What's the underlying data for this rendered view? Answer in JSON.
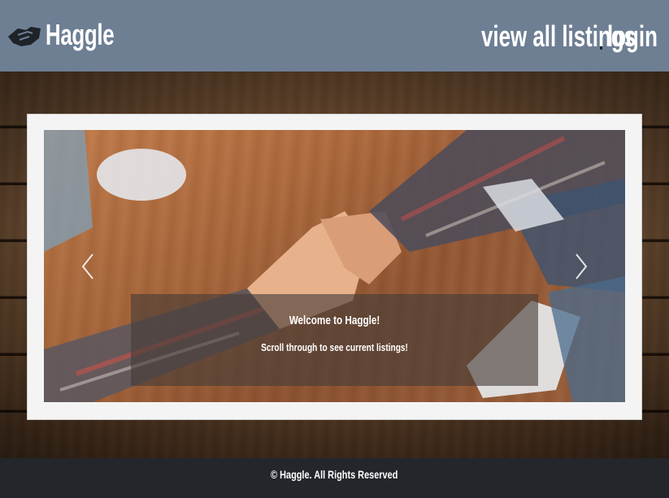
{
  "header": {
    "brand_name": "Haggle",
    "brand_icon": "handshake-icon",
    "nav": {
      "view_all_listings": "view all listings",
      "separator": "|",
      "login": "login"
    }
  },
  "carousel": {
    "caption_title": "Welcome to Haggle!",
    "caption_subtitle": "Scroll through to see current listings!",
    "prev_icon": "chevron-left-icon",
    "next_icon": "chevron-right-icon"
  },
  "footer": {
    "copyright": "© Haggle.  All Rights Reserved"
  },
  "colors": {
    "header_bg": "#6e7f94",
    "footer_bg": "#23272c",
    "text": "#ffffff"
  }
}
